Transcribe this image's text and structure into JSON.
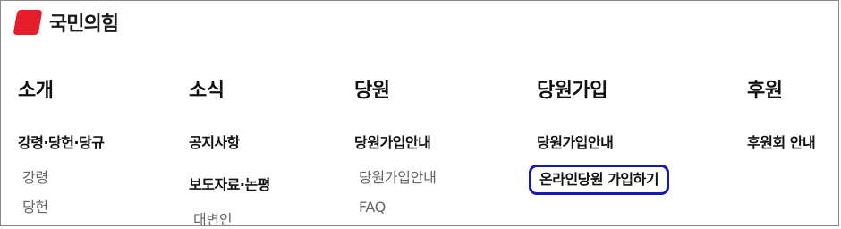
{
  "brand": {
    "name": "국민의힘",
    "color": "#e61e2b"
  },
  "menu": [
    {
      "title": "소개",
      "items": [
        {
          "label": "강령·당헌·당규",
          "sub": [
            "강령",
            "당헌"
          ]
        }
      ]
    },
    {
      "title": "소식",
      "items": [
        {
          "label": "공지사항"
        },
        {
          "label": "보도자료·논평",
          "sub": [
            "대변인"
          ]
        }
      ]
    },
    {
      "title": "당원",
      "items": [
        {
          "label": "당원가입안내",
          "sub": [
            "당원가입안내",
            "FAQ"
          ]
        }
      ]
    },
    {
      "title": "당원가입",
      "items": [
        {
          "label": "당원가입안내"
        },
        {
          "label": "온라인당원 가입하기",
          "highlighted": true
        }
      ]
    },
    {
      "title": "후원",
      "items": [
        {
          "label": "후원회 안내"
        }
      ]
    }
  ],
  "highlight_color": "#1515b8"
}
